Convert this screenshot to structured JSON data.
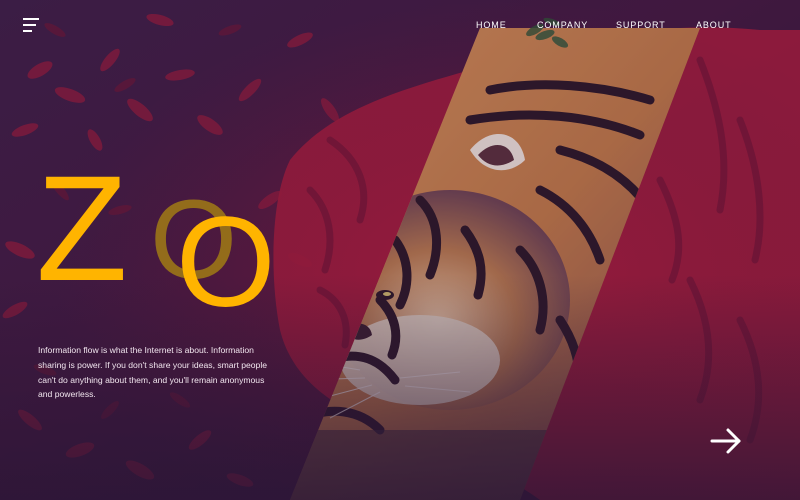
{
  "nav": {
    "items": [
      {
        "label": "HOME"
      },
      {
        "label": "COMPANY"
      },
      {
        "label": "SUPPORT"
      },
      {
        "label": "ABOUT"
      }
    ]
  },
  "hero": {
    "logo_letters": [
      "Z",
      "O",
      "O"
    ],
    "description": "Information flow is what the Internet is about. Information sharing is power. If you don't share your ideas, smart people can't do anything about them, and you'll remain anonymous and powerless."
  },
  "icons": {
    "menu": "hamburger-menu-icon",
    "next": "arrow-right-icon"
  },
  "colors": {
    "background": "#2b1838",
    "overlay_red": "#8a1b3a",
    "accent_yellow": "#ffb400",
    "accent_olive": "#9a7418",
    "tiger_orange": "#c9773f",
    "text": "#ffffff"
  }
}
